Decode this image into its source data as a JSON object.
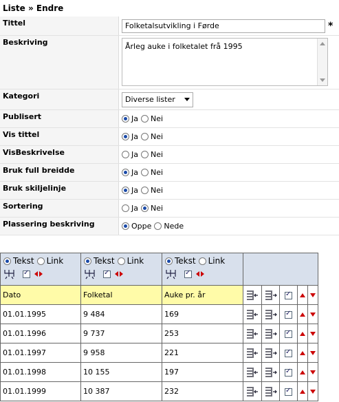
{
  "breadcrumb": "Liste » Endre",
  "fields": {
    "tittel": {
      "label": "Tittel",
      "value": "Folketalsutvikling i Førde",
      "required": "*"
    },
    "beskriving": {
      "label": "Beskriving",
      "value": "Årleg auke i folketalet frå 1995"
    },
    "kategori": {
      "label": "Kategori",
      "selected": "Diverse lister"
    },
    "publisert": {
      "label": "Publisert",
      "options": [
        "Ja",
        "Nei"
      ],
      "selected": "Ja"
    },
    "vis_tittel": {
      "label": "Vis tittel",
      "options": [
        "Ja",
        "Nei"
      ],
      "selected": "Ja"
    },
    "vis_beskrivelse": {
      "label": "VisBeskrivelse",
      "options": [
        "Ja",
        "Nei"
      ],
      "selected": "none"
    },
    "bruk_full_breidde": {
      "label": "Bruk full breidde",
      "options": [
        "Ja",
        "Nei"
      ],
      "selected": "Ja"
    },
    "bruk_skiljelinje": {
      "label": "Bruk skiljelinje",
      "options": [
        "Ja",
        "Nei"
      ],
      "selected": "Ja"
    },
    "sortering": {
      "label": "Sortering",
      "options": [
        "Ja",
        "Nei"
      ],
      "selected": "Nei"
    },
    "plassering": {
      "label": "Plassering beskriving",
      "options": [
        "Oppe",
        "Nede"
      ],
      "selected": "Oppe"
    }
  },
  "table": {
    "column_type_options": [
      "Tekst",
      "Link"
    ],
    "column_type_selected": "Tekst",
    "headers": [
      "Dato",
      "Folketal",
      "Auke pr. år"
    ],
    "rows": [
      [
        "01.01.1995",
        "9 484",
        "169"
      ],
      [
        "01.01.1996",
        "9 737",
        "253"
      ],
      [
        "01.01.1997",
        "9 958",
        "221"
      ],
      [
        "01.01.1998",
        "10 155",
        "197"
      ],
      [
        "01.01.1999",
        "10 387",
        "232"
      ]
    ]
  },
  "colors": {
    "header_bg": "#fffba8",
    "control_bg": "#d8e0ec",
    "arrow_red": "#cc0000",
    "radio_blue": "#1a4aa8"
  },
  "icons": [
    "insert-column-left-icon",
    "insert-column-right-icon",
    "row-checkbox",
    "move-row-up-icon",
    "move-row-down-icon",
    "move-column-left-icon",
    "move-column-right-icon",
    "split-columns-icon"
  ]
}
